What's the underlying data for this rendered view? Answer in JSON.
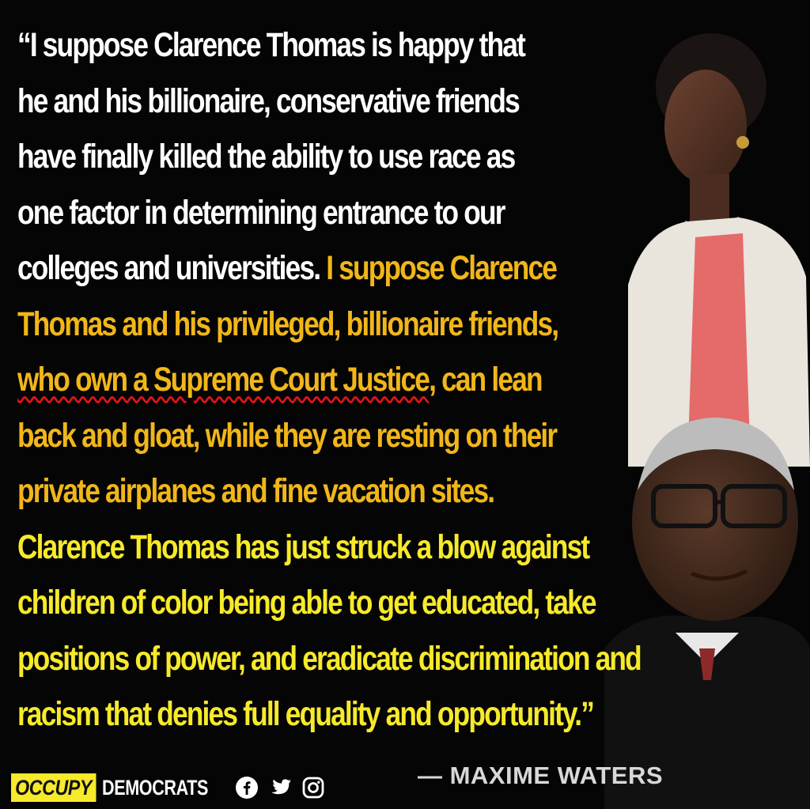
{
  "quote": {
    "lines": [
      {
        "segments": [
          {
            "text": "“I suppose Clarence Thomas is happy that",
            "color": "white"
          }
        ]
      },
      {
        "segments": [
          {
            "text": "he and his billionaire, conservative friends",
            "color": "white"
          }
        ]
      },
      {
        "segments": [
          {
            "text": "have finally killed the ability to use race as",
            "color": "white"
          }
        ]
      },
      {
        "segments": [
          {
            "text": "one factor in determining entrance to our",
            "color": "white"
          }
        ]
      },
      {
        "segments": [
          {
            "text": "colleges and universities. ",
            "color": "white"
          },
          {
            "text": "I suppose Clarence",
            "color": "gold"
          }
        ]
      },
      {
        "segments": [
          {
            "text": "Thomas and his privileged, billionaire friends,",
            "color": "gold"
          }
        ]
      },
      {
        "segments": [
          {
            "text": "who own a Supreme Court Justice",
            "color": "gold"
          },
          {
            "text": ", can lean",
            "color": "gold"
          }
        ]
      },
      {
        "segments": [
          {
            "text": "back and gloat, while they are resting on their",
            "color": "gold"
          }
        ]
      },
      {
        "segments": [
          {
            "text": "private airplanes and fine vacation sites.",
            "color": "gold"
          }
        ]
      },
      {
        "segments": [
          {
            "text": "Clarence Thomas has just struck a blow against",
            "color": "yellow"
          }
        ]
      },
      {
        "segments": [
          {
            "text": "children of color being able to get educated, take",
            "color": "yellow"
          }
        ]
      },
      {
        "segments": [
          {
            "text": "positions of power, and eradicate discrimination and",
            "color": "yellow"
          }
        ]
      },
      {
        "segments": [
          {
            "text": "racism that denies full equality and opportunity.”",
            "color": "yellow"
          }
        ]
      }
    ]
  },
  "attribution": "— MAXIME WATERS",
  "brand": {
    "occupy": "OCCUPY",
    "democrats": "DEMOCRATS"
  },
  "social_icons": [
    "facebook-icon",
    "twitter-icon",
    "instagram-icon"
  ],
  "colors": {
    "background": "#050505",
    "white": "#ffffff",
    "gold": "#f1b619",
    "yellow": "#f6ea2a",
    "underline": "#e0141c"
  }
}
